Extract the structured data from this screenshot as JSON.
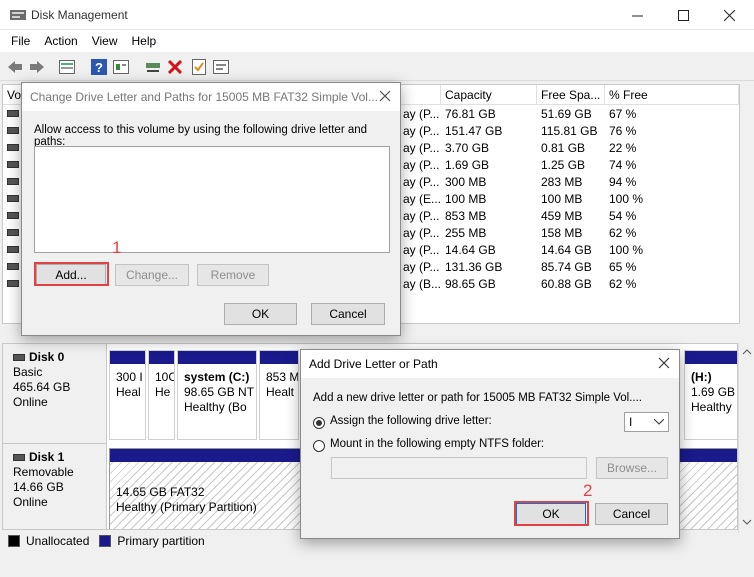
{
  "window": {
    "title": "Disk Management",
    "menu": [
      "File",
      "Action",
      "View",
      "Help"
    ]
  },
  "toolbar": {
    "icons": [
      "back-arrow-icon",
      "forward-arrow-icon",
      "list-view-icon",
      "help-icon",
      "properties-icon",
      "connect-icon",
      "delete-icon",
      "check-icon",
      "settings-icon"
    ]
  },
  "volume_list": {
    "headers": [
      "Vo",
      "Capacity",
      "Free Spa...",
      "% Free"
    ],
    "rows": [
      {
        "status": "ay (P...",
        "capacity": "76.81 GB",
        "free": "51.69 GB",
        "pct": "67 %"
      },
      {
        "status": "ay (P...",
        "capacity": "151.47 GB",
        "free": "115.81 GB",
        "pct": "76 %"
      },
      {
        "status": "ay (P...",
        "capacity": "3.70 GB",
        "free": "0.81 GB",
        "pct": "22 %"
      },
      {
        "status": "ay (P...",
        "capacity": "1.69 GB",
        "free": "1.25 GB",
        "pct": "74 %"
      },
      {
        "status": "ay (P...",
        "capacity": "300 MB",
        "free": "283 MB",
        "pct": "94 %"
      },
      {
        "status": "ay (E...",
        "capacity": "100 MB",
        "free": "100 MB",
        "pct": "100 %"
      },
      {
        "status": "ay (P...",
        "capacity": "853 MB",
        "free": "459 MB",
        "pct": "54 %"
      },
      {
        "status": "ay (P...",
        "capacity": "255 MB",
        "free": "158 MB",
        "pct": "62 %"
      },
      {
        "status": "ay (P...",
        "capacity": "14.64 GB",
        "free": "14.64 GB",
        "pct": "100 %"
      },
      {
        "status": "ay (P...",
        "capacity": "131.36 GB",
        "free": "85.74 GB",
        "pct": "65 %"
      },
      {
        "status": "ay (B...",
        "capacity": "98.65 GB",
        "free": "60.88 GB",
        "pct": "62 %"
      }
    ]
  },
  "disks": {
    "disk0": {
      "name": "Disk 0",
      "type": "Basic",
      "size": "465.64 GB",
      "status": "Online",
      "partitions": [
        {
          "line1": "300 I",
          "line2": "Heal"
        },
        {
          "line1": "10C",
          "line2": "He"
        },
        {
          "title": "system  (C:)",
          "line1": "98.65 GB NT",
          "line2": "Healthy (Bo"
        },
        {
          "line1": "853 M",
          "line2": "Healt"
        },
        {
          "title": "(H:)",
          "line1": "1.69 GB",
          "line2": "Healthy"
        }
      ]
    },
    "disk1": {
      "name": "Disk 1",
      "type": "Removable",
      "size": "14.66 GB",
      "status": "Online",
      "partition": {
        "line1": "14.65 GB FAT32",
        "line2": "Healthy (Primary Partition)"
      }
    }
  },
  "legend": {
    "unallocated": "Unallocated",
    "primary": "Primary partition"
  },
  "change_dialog": {
    "title": "Change Drive Letter and Paths for 15005 MB FAT32 Simple Vol...",
    "prompt": "Allow access to this volume by using the following drive letter and paths:",
    "add": "Add...",
    "change": "Change...",
    "remove": "Remove",
    "ok": "OK",
    "cancel": "Cancel",
    "step": "1"
  },
  "add_dialog": {
    "title": "Add Drive Letter or Path",
    "prompt": "Add a new drive letter or path for 15005 MB FAT32 Simple Vol....",
    "assign": "Assign the following drive letter:",
    "letter": "I",
    "mount": "Mount in the following empty NTFS folder:",
    "browse": "Browse...",
    "ok": "OK",
    "cancel": "Cancel",
    "step": "2"
  },
  "colors": {
    "primary_partition": "#1a1a8c",
    "highlight": "#e04343"
  }
}
